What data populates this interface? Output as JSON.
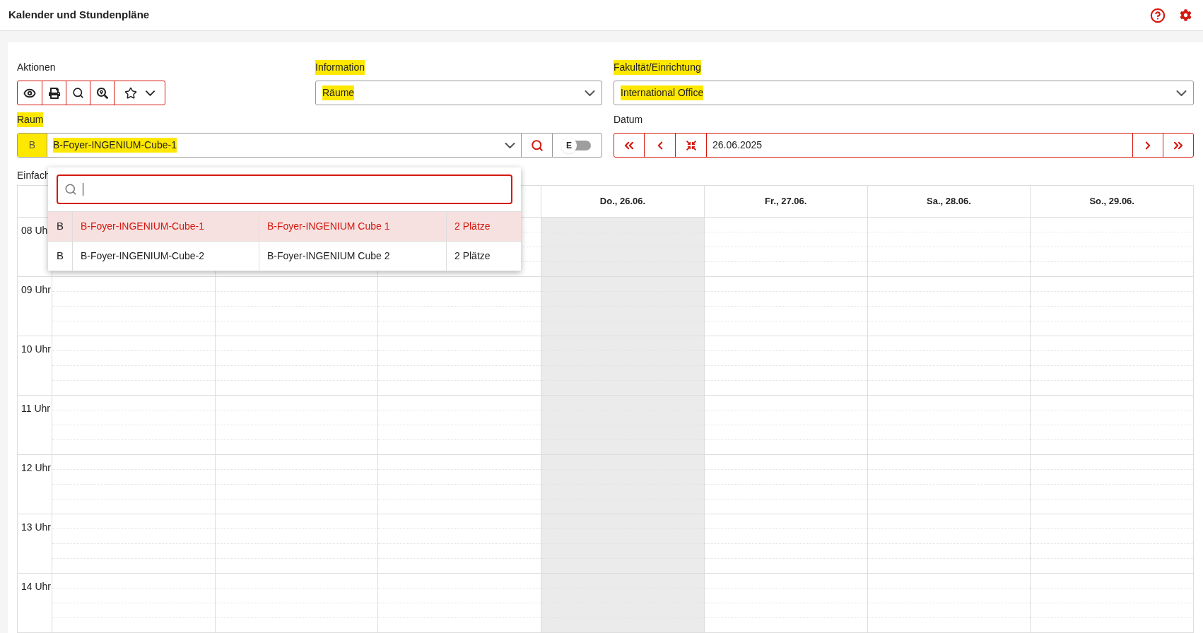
{
  "header": {
    "title": "Kalender und Stundenpläne"
  },
  "actions": {
    "label": "Aktionen"
  },
  "information": {
    "label": "Information",
    "value": "Räume",
    "highlighted": true
  },
  "faculty": {
    "label": "Fakultät/Einrichtung",
    "value": "International Office",
    "highlighted": true
  },
  "room": {
    "label": "Raum",
    "prefix": "B",
    "value": "B-Foyer-INGENIUM-Cube-1",
    "highlighted": true,
    "toggle_label": "E",
    "toggle_on": false
  },
  "date": {
    "label": "Datum",
    "value": "26.06.2025"
  },
  "view_label": "Einfach",
  "days": [
    {
      "today": false
    },
    {
      "today": false
    },
    {
      "today": false
    },
    {
      "label": "Do., 26.06.",
      "today": true
    },
    {
      "label": "Fr., 27.06.",
      "today": false
    },
    {
      "label": "Sa., 28.06.",
      "today": false
    },
    {
      "label": "So., 29.06.",
      "today": false
    }
  ],
  "hours": [
    "08 Uh",
    "09 Uhr",
    "10 Uhr",
    "11 Uhr",
    "12 Uhr",
    "13 Uhr",
    "14 Uhr"
  ],
  "dropdown": {
    "rows": [
      {
        "building": "B",
        "name": "B-Foyer-INGENIUM-Cube-1",
        "description": "B-Foyer-INGENIUM Cube 1",
        "seats": "2 Plätze",
        "selected": true
      },
      {
        "building": "B",
        "name": "B-Foyer-INGENIUM-Cube-2",
        "description": "B-Foyer-INGENIUM Cube 2",
        "seats": "2 Plätze",
        "selected": false
      }
    ]
  }
}
